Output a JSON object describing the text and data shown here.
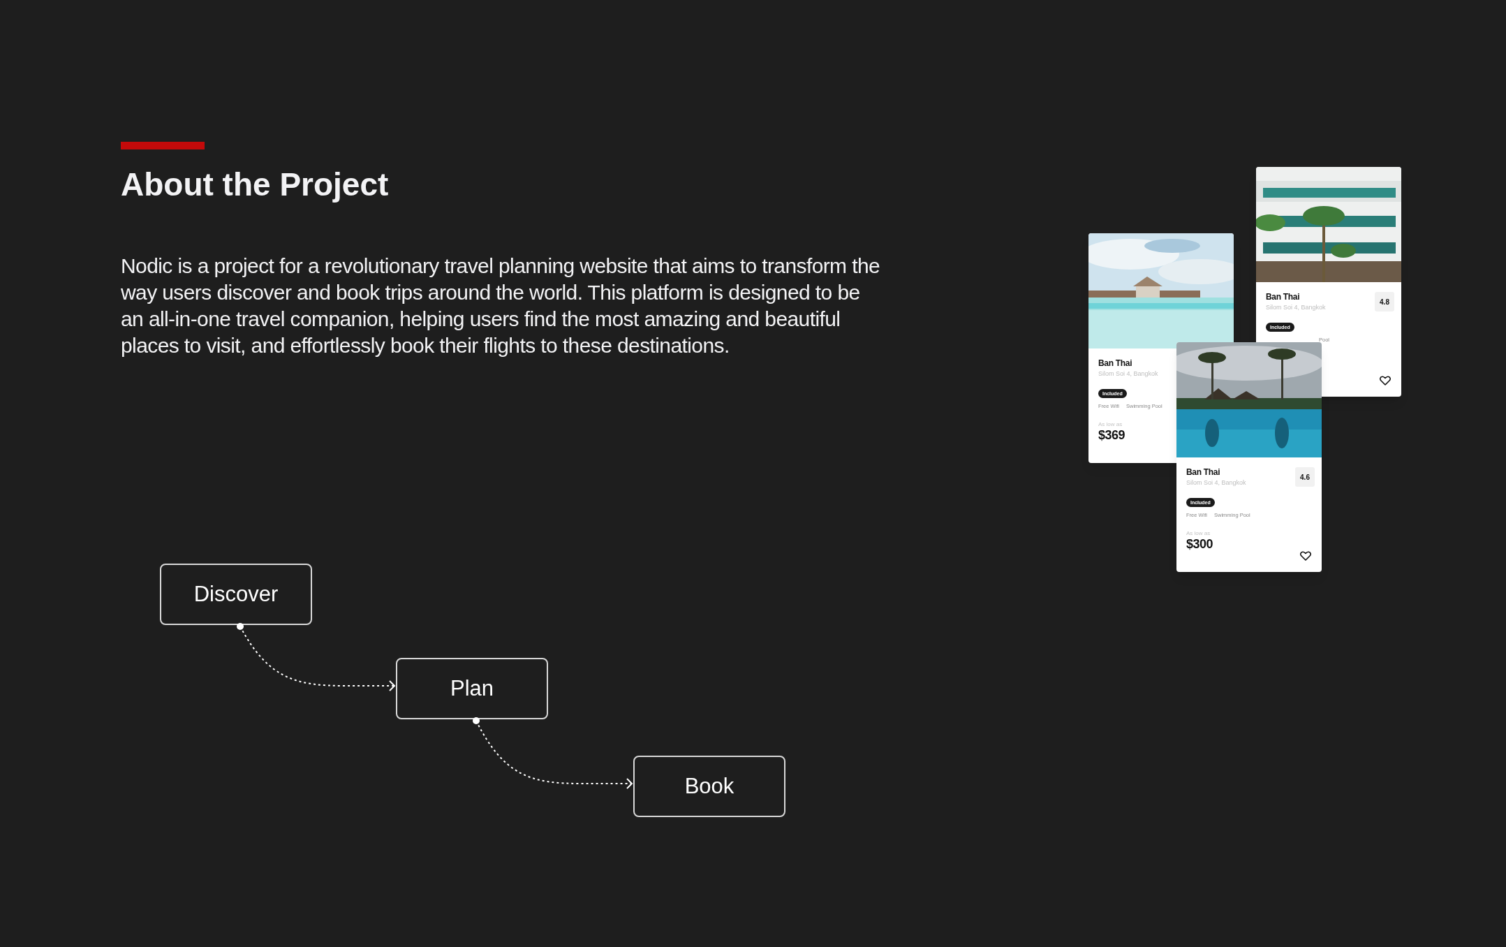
{
  "section": {
    "title": "About the Project",
    "description": "Nodic is a project for a revolutionary travel planning website that aims to transform the way users discover and book trips around the world. This platform is designed to be an all-in-one travel companion, helping users find the most amazing and beautiful places to visit, and effortlessly book their flights to these destinations."
  },
  "flow": {
    "steps": [
      {
        "label": "Discover"
      },
      {
        "label": "Plan"
      },
      {
        "label": "Book"
      }
    ]
  },
  "cards": [
    {
      "picture": {
        "kind": "picture"
      },
      "name": "Ban Thai",
      "location": "Silom Soi 4, Bangkok",
      "badge": "Included",
      "amenities": [
        "Free Wifi",
        "Swimming Pool"
      ],
      "price_label": "As low as",
      "price": "$369"
    },
    {
      "picture": {
        "kind": "picture"
      },
      "name": "Ban Thai",
      "location": "Silom Soi 4, Bangkok",
      "rating": "4.8",
      "badge": "Included",
      "amenities": [
        "Pool"
      ]
    },
    {
      "picture": {
        "kind": "picture"
      },
      "name": "Ban Thai",
      "location": "Silom Soi 4, Bangkok",
      "rating": "4.6",
      "badge": "Included",
      "amenities": [
        "Free Wifi",
        "Swimming Pool"
      ],
      "price_label": "As low as",
      "price": "$300"
    }
  ]
}
